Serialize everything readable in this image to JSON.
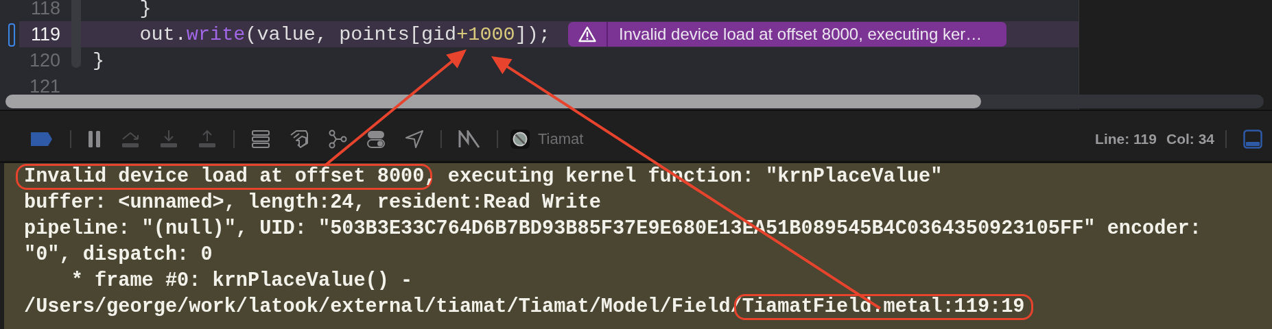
{
  "editor": {
    "lines": [
      {
        "number": "118",
        "current": false,
        "tokens": [
          {
            "kind": "plain",
            "text": "    }"
          }
        ]
      },
      {
        "number": "119",
        "current": true,
        "tokens": [
          {
            "kind": "plain",
            "text": "    out."
          },
          {
            "kind": "method",
            "text": "write"
          },
          {
            "kind": "plain",
            "text": "(value, points[gid"
          },
          {
            "kind": "number",
            "text": "+1000"
          },
          {
            "kind": "plain",
            "text": "]);"
          }
        ],
        "issue": {
          "message": "Invalid device load at offset 8000, executing ker…"
        }
      },
      {
        "number": "120",
        "current": false,
        "tokens": [
          {
            "kind": "plain",
            "text": "}"
          }
        ]
      },
      {
        "number": "121",
        "current": false
      }
    ]
  },
  "toolbar": {
    "groups": [
      [
        {
          "kind": "breakpoints",
          "on": true
        }
      ],
      [
        {
          "kind": "pause",
          "disabled": false
        },
        {
          "kind": "step-over",
          "disabled": true
        },
        {
          "kind": "step-into",
          "disabled": true
        },
        {
          "kind": "step-out",
          "disabled": true
        }
      ],
      [
        {
          "kind": "stack"
        },
        {
          "kind": "layers"
        },
        {
          "kind": "graph"
        },
        {
          "kind": "toggles"
        },
        {
          "kind": "location"
        }
      ],
      [
        {
          "kind": "metal"
        }
      ]
    ],
    "process": {
      "name": "Tiamat"
    },
    "line": "Line: 119",
    "column": "Col: 34",
    "panel_toggle": {
      "on": true
    }
  },
  "console": {
    "lines": [
      {
        "parts": [
          {
            "text": "Invalid device load at offset 8000",
            "circled": true
          },
          {
            "text": ", executing kernel function: \"krnPlaceValue\"",
            "circled": false
          }
        ]
      },
      {
        "parts": [
          {
            "text": "buffer: <unnamed>, length:24, resident:Read Write",
            "circled": false
          }
        ]
      },
      {
        "parts": [
          {
            "text": "pipeline: \"(null)\", UID: \"503B3E33C764D6B7BD93B85F37E9E680E13EA51B089545B4C0364350923105FF\" encoder:",
            "circled": false
          }
        ]
      },
      {
        "parts": [
          {
            "text": "\"0\", dispatch: 0",
            "circled": false
          }
        ]
      },
      {
        "parts": [
          {
            "text": "    * frame #0: krnPlaceValue() -",
            "circled": false
          }
        ]
      },
      {
        "parts": [
          {
            "text": "/Users/george/work/latook/external/tiamat/Tiamat/Model/Field/",
            "circled": false
          },
          {
            "text": "TiamatField.metal:119:19",
            "circled": true
          }
        ]
      }
    ]
  }
}
